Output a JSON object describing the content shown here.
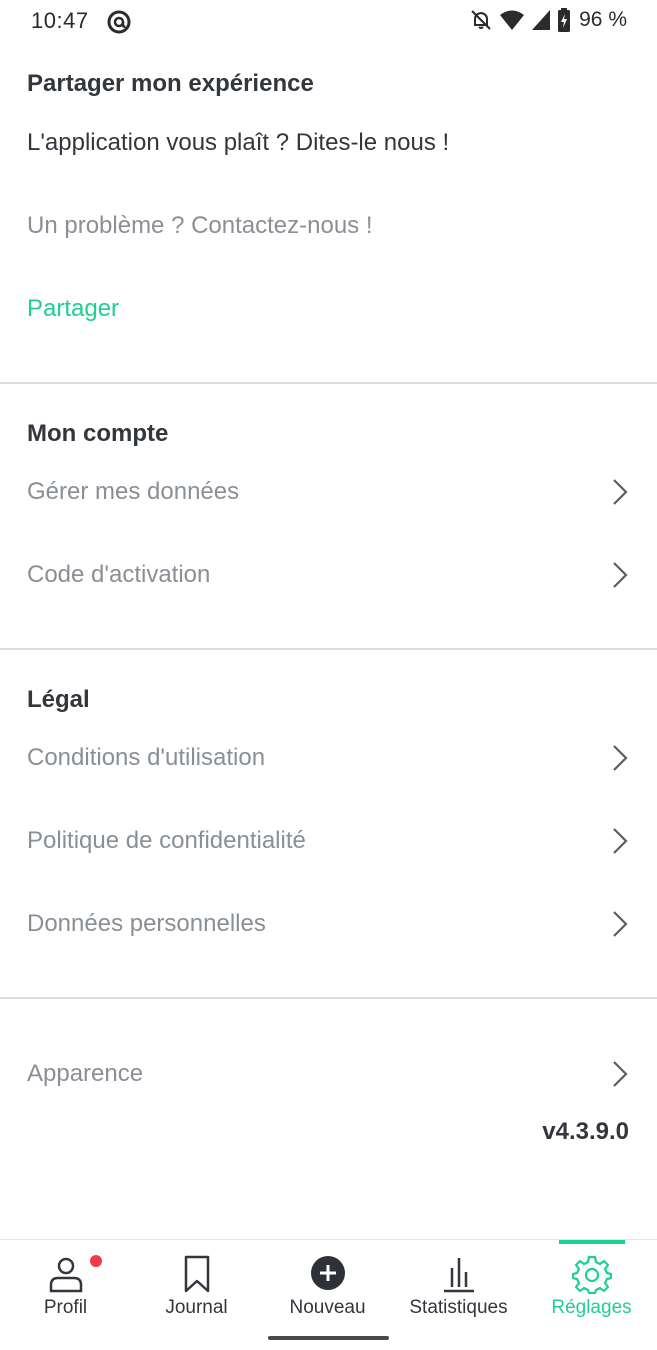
{
  "status_bar": {
    "time": "10:47",
    "battery_percent": "96 %",
    "icons": [
      "at-sign-icon",
      "bell-off-icon",
      "wifi-icon",
      "signal-icon",
      "battery-charging-icon"
    ]
  },
  "share_section": {
    "title": "Partager mon expérience",
    "like_text": "L'application vous plaît ? Dites-le nous !",
    "problem_text": "Un problème ? Contactez-nous !",
    "share_link": "Partager"
  },
  "account_section": {
    "title": "Mon compte",
    "items": [
      {
        "label": "Gérer mes données",
        "icon": "chevron-right-icon"
      },
      {
        "label": "Code d'activation",
        "icon": "chevron-right-icon"
      }
    ]
  },
  "legal_section": {
    "title": "Légal",
    "items": [
      {
        "label": "Conditions d'utilisation",
        "icon": "chevron-right-icon"
      },
      {
        "label": "Politique de confidentialité",
        "icon": "chevron-right-icon"
      },
      {
        "label": "Données personnelles",
        "icon": "chevron-right-icon"
      }
    ]
  },
  "appearance": {
    "label": "Apparence",
    "icon": "chevron-right-icon"
  },
  "version": "v4.3.9.0",
  "bottom_nav": {
    "items": [
      {
        "label": "Profil",
        "icon": "user-icon",
        "has_badge": true
      },
      {
        "label": "Journal",
        "icon": "bookmark-icon"
      },
      {
        "label": "Nouveau",
        "icon": "plus-circle-icon"
      },
      {
        "label": "Statistiques",
        "icon": "bar-chart-icon"
      },
      {
        "label": "Réglages",
        "icon": "gear-icon",
        "active": true
      }
    ]
  },
  "colors": {
    "accent": "#1fcf8f",
    "text_dark": "#33373d",
    "text_muted": "#8a8f96",
    "divider": "#d8dee6",
    "badge": "#f03c4a"
  }
}
